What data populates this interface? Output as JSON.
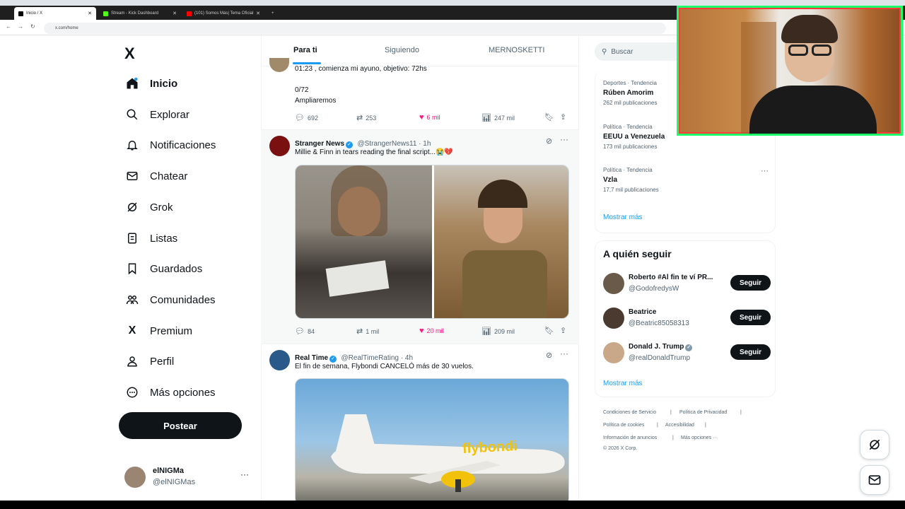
{
  "browser": {
    "tabs": [
      {
        "title": "Inicio / X"
      },
      {
        "title": "Stream - Kick Dashboard"
      },
      {
        "title": "(101) Somos Más| Tema Oficial"
      }
    ],
    "url": "x.com/home"
  },
  "sidebar": {
    "logo": "X",
    "items": [
      {
        "label": "Inicio",
        "icon": "home-icon"
      },
      {
        "label": "Explorar",
        "icon": "search-icon"
      },
      {
        "label": "Notificaciones",
        "icon": "bell-icon"
      },
      {
        "label": "Chatear",
        "icon": "mail-icon"
      },
      {
        "label": "Grok",
        "icon": "grok-icon"
      },
      {
        "label": "Listas",
        "icon": "list-icon"
      },
      {
        "label": "Guardados",
        "icon": "bookmark-icon"
      },
      {
        "label": "Comunidades",
        "icon": "people-icon"
      },
      {
        "label": "Premium",
        "icon": "x-logo-icon"
      },
      {
        "label": "Perfil",
        "icon": "person-icon"
      },
      {
        "label": "Más opciones",
        "icon": "more-circle-icon"
      }
    ],
    "post_label": "Postear",
    "account": {
      "name": "elNIGMa",
      "handle": "@elNIGMas"
    }
  },
  "feed": {
    "tabs": [
      "Para ti",
      "Siguiendo",
      "MERNOSKETTI"
    ],
    "tweet1": {
      "line1": "01:23 , comienza mi ayuno, objetivo: 72hs",
      "line2": "0/72",
      "line3": "Ampliaremos",
      "replies": "692",
      "reposts": "253",
      "likes": "6 mil",
      "views": "247 mil"
    },
    "tweet2": {
      "name": "Stranger News",
      "handle": "@StrangerNews11 · 1h",
      "text": "Millie & Finn in tears reading the final script...😭💔",
      "replies": "84",
      "reposts": "1 mil",
      "likes": "20 mil",
      "views": "209 mil"
    },
    "tweet3": {
      "name": "Real Time",
      "handle": "@RealTimeRating · 4h",
      "text": "El fin de semana, Flybondi CANCELÓ más de 30 vuelos.",
      "plane_brand": "flybondi"
    }
  },
  "right": {
    "search_placeholder": "Buscar",
    "trends": [
      {
        "meta": "Deportes · Tendencia",
        "title": "Rúben Amorim",
        "count": "262 mil publicaciones"
      },
      {
        "meta": "Política · Tendencia",
        "title": "EEUU a Venezuela",
        "count": "173 mil publicaciones"
      },
      {
        "meta": "Política · Tendencia",
        "title": "Vzla",
        "count": "17,7 mil publicaciones"
      }
    ],
    "show_more": "Mostrar más",
    "who_to_follow_title": "A quién seguir",
    "follow": [
      {
        "name": "Roberto #Al fin te ví PR...",
        "handle": "@GodofredysW",
        "button": "Seguir"
      },
      {
        "name": "Beatrice",
        "handle": "@Beatric85058313",
        "button": "Seguir"
      },
      {
        "name": "Donald J. Trump",
        "handle": "@realDonaldTrump",
        "button": "Seguir"
      }
    ],
    "follow_show_more": "Mostrar más",
    "footer": {
      "terms": "Condiciones de Servicio",
      "privacy": "Política de Privacidad",
      "cookies": "Política de cookies",
      "accessibility": "Accesibilidad",
      "ads": "Información de anuncios",
      "more": "Más opciones ···",
      "copyright": "© 2026 X Corp."
    }
  },
  "colors": {
    "accent": "#1d9bf0",
    "like": "#f91880",
    "text": "#0f1419",
    "muted": "#536471"
  }
}
